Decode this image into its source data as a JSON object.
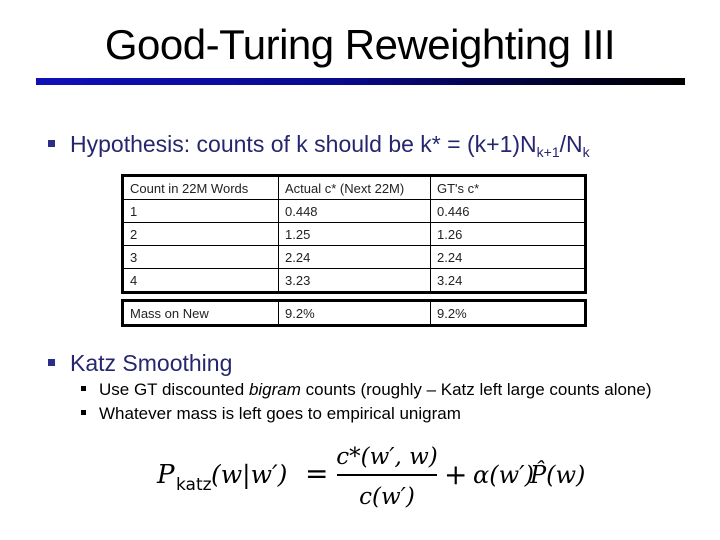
{
  "slide": {
    "title": "Good-Turing Reweighting III",
    "title_bar_colors": [
      "#1010b8",
      "#000000"
    ]
  },
  "hypothesis": {
    "prefix": "Hypothesis: counts of k should be k* = (k+1)N",
    "sub1": "k+1",
    "mid": "/N",
    "sub2": "k"
  },
  "table": {
    "headers": [
      "Count in 22M Words",
      "Actual c* (Next 22M)",
      "GT's c*"
    ],
    "rows": [
      [
        "1",
        "0.448",
        "0.446"
      ],
      [
        "2",
        "1.25",
        "1.26"
      ],
      [
        "3",
        "2.24",
        "2.24"
      ],
      [
        "4",
        "3.23",
        "3.24"
      ]
    ],
    "mass_row": [
      "Mass on New",
      "9.2%",
      "9.2%"
    ]
  },
  "katz": {
    "heading": "Katz Smoothing",
    "sub_bullets": [
      {
        "before": "Use GT discounted ",
        "italic": "bigram",
        "after": " counts (roughly – Katz left large counts alone)"
      },
      {
        "before": "Whatever mass is left goes to empirical unigram",
        "italic": "",
        "after": ""
      }
    ]
  },
  "formula": {
    "lhs_P": "P",
    "lhs_sub": "katz",
    "lhs_args": "(w|w′)",
    "equals": "=",
    "numerator": "c*(w′, w)",
    "denominator": "c(w′)",
    "plus": "+",
    "alpha_term": "α(w′)",
    "phat": "P̂(w)"
  }
}
